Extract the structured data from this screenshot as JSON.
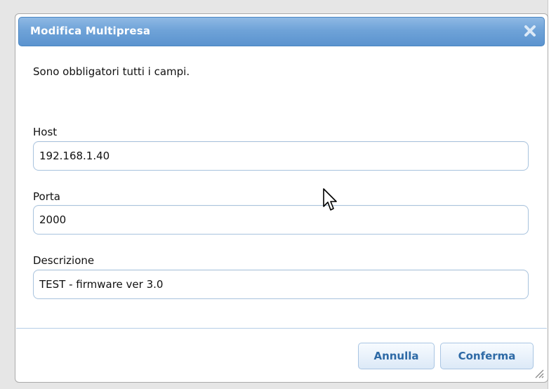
{
  "dialog": {
    "title": "Modifica Multipresa",
    "close_icon": "close-icon",
    "intro": "Sono obbligatori tutti i campi."
  },
  "fields": {
    "host": {
      "label": "Host",
      "value": "192.168.1.40"
    },
    "port": {
      "label": "Porta",
      "value": "2000"
    },
    "description": {
      "label": "Descrizione",
      "value": "TEST - firmware ver 3.0"
    }
  },
  "buttons": {
    "cancel": "Annulla",
    "confirm": "Conferma"
  },
  "colors": {
    "titlebar": "#6fa3d8",
    "button_text": "#2e6aa6",
    "input_border": "#a8c3de"
  }
}
